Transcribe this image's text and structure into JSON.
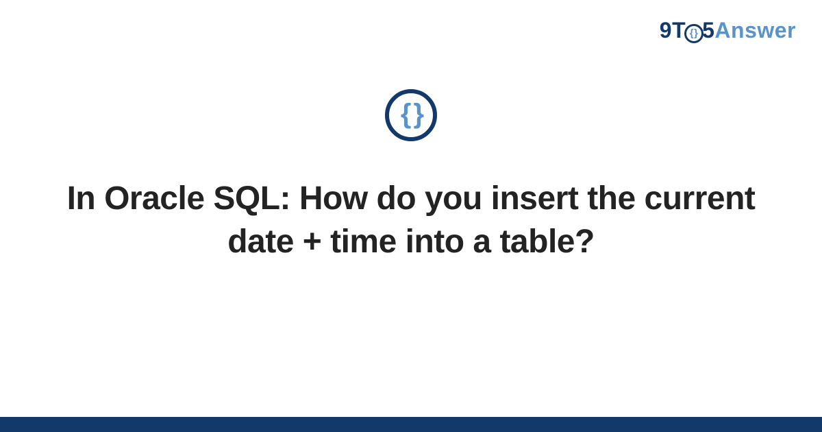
{
  "brand": {
    "part1": "9T",
    "circle_glyph": "{}",
    "part2": "5",
    "part3": "Answer"
  },
  "badge": {
    "glyph": "{ }"
  },
  "question": {
    "title": "In Oracle SQL: How do you insert the current date + time into a table?"
  },
  "colors": {
    "brand_dark": "#13396b",
    "brand_light": "#5a93c9",
    "text": "#232323"
  }
}
